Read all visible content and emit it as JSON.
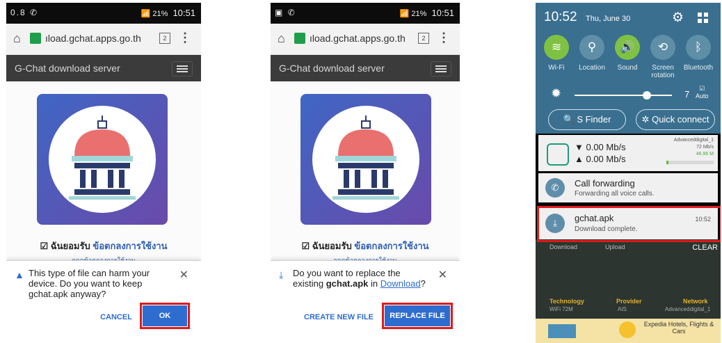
{
  "screens": {
    "left": {
      "status_time": "10:51",
      "status_left": "0.8",
      "battery": "21%",
      "url": "ıload.gchat.apps.go.th",
      "tab_count": "2",
      "site_title": "G-Chat download server",
      "agree_prefix": "☑ ฉันยอมรับ",
      "agree_link": "ข้อตกลงการใช้งาน",
      "agree_sub": "กดดูข้อตกลงการใช้งาน",
      "dialog_message": "This type of file can harm your device. Do you want to keep gchat.apk anyway?",
      "cancel_label": "CANCEL",
      "ok_label": "OK"
    },
    "middle": {
      "status_time": "10:51",
      "battery": "21%",
      "url": "ıload.gchat.apps.go.th",
      "tab_count": "2",
      "site_title": "G-Chat download server",
      "agree_prefix": "☑ ฉันยอมรับ",
      "agree_link": "ข้อตกลงการใช้งาน",
      "agree_sub": "กดดูข้อตกลงการใช้งาน",
      "dialog_prefix": "Do you want to replace the existing ",
      "dialog_file": "gchat.apk",
      "dialog_in": " in ",
      "dialog_link": "Download",
      "dialog_suffix": "?",
      "create_label": "CREATE NEW FILE",
      "replace_label": "REPLACE FILE"
    },
    "right": {
      "time": "10:52",
      "date": "Thu, June 30",
      "quick": [
        {
          "label": "Wi-Fi"
        },
        {
          "label": "Location"
        },
        {
          "label": "Sound"
        },
        {
          "label": "Screen rotation"
        },
        {
          "label": "Bluetooth"
        }
      ],
      "brightness_value": "7",
      "brightness_auto": "Auto",
      "sfinder": "S Finder",
      "quick_connect": "Quick connect",
      "speed_down": "0.00 Mb/s",
      "speed_up": "0.00 Mb/s",
      "net_name": "Advanceddigital_1",
      "net_speed": "72 Mb/s",
      "net_data": "46.96 M",
      "call_title": "Call forwarding",
      "call_sub": "Forwarding all voice calls.",
      "dl_title": "gchat.apk",
      "dl_sub": "Download complete.",
      "dl_time": "10:52",
      "row_labels": [
        "Download",
        "Upload"
      ],
      "clear": "CLEAR",
      "table_headers": [
        "Technology",
        "Provider",
        "Network"
      ],
      "table_values": [
        "WiFi 72M",
        "AIS",
        "Advanceddigital_1"
      ],
      "ad_text": "Expedia Hotels, Flights & Cars"
    }
  }
}
